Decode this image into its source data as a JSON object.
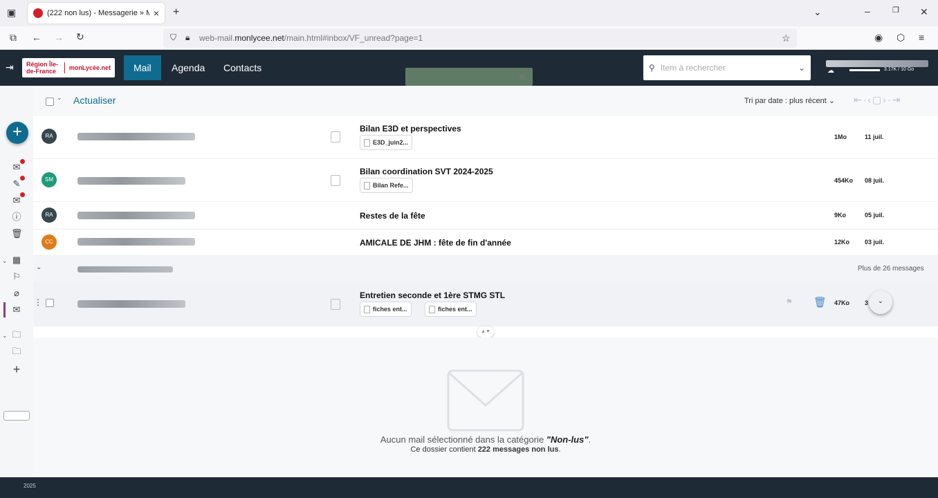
{
  "browser": {
    "tab_title": "(222 non lus) - Messagerie » M...",
    "tab_close": "×",
    "new_tab": "+",
    "url_prefix": "web-mail.",
    "url_host": "monlycee.net",
    "url_path": "/main.html#inbox/VF_unread?page=1",
    "window_controls": [
      "⌄",
      "–",
      "❐",
      "✕"
    ]
  },
  "app": {
    "logo_left": "Région Île-de-France",
    "logo_right": "monLycée.net",
    "nav": [
      "Mail",
      "Agenda",
      "Contacts"
    ],
    "active_nav": "Mail",
    "search_placeholder": "Item à rechercher",
    "quota_text": "3.17K / 10 Go",
    "accent": "#0f6b8f",
    "header_bg": "#1f2a37"
  },
  "toolbar": {
    "refresh_label": "Actualiser",
    "sort_label": "Tri par date : plus récent"
  },
  "messages": [
    {
      "initials": "RA",
      "avatar_color": "#37474f",
      "subject": "Bilan E3D et perspectives",
      "attachments": [
        "E3D_juin2..."
      ],
      "size": "1Mo",
      "date": "11 juil."
    },
    {
      "initials": "SM",
      "avatar_color": "#1e9b7a",
      "subject": "Bilan coordination SVT 2024-2025",
      "attachments": [
        "Bilan Refe..."
      ],
      "size": "454Ko",
      "date": "08 juil."
    },
    {
      "initials": "RA",
      "avatar_color": "#37474f",
      "subject": "Restes de la fête",
      "attachments": [],
      "size": "9Ko",
      "date": "05 juil."
    },
    {
      "initials": "CC",
      "avatar_color": "#e07b1a",
      "subject": "AMICALE DE JHM : fête de fin d'année",
      "attachments": [],
      "size": "12Ko",
      "date": "03 juil."
    }
  ],
  "group": {
    "more_label": "Plus de 26 messages"
  },
  "hover_message": {
    "subject": "Entretien seconde et 1ère STMG STL",
    "attachments": [
      "fiches ent...",
      "fiches ent..."
    ],
    "size": "47Ko",
    "date_truncated": "3"
  },
  "preview": {
    "no_selection_prefix": "Aucun mail sélectionné dans la catégorie ",
    "category": "\"Non-lus\"",
    "no_selection_suffix": ".",
    "count_prefix": "Ce dossier contient ",
    "count_value": "222 messages non lus",
    "count_suffix": "."
  },
  "footer": {
    "year": "2025"
  }
}
